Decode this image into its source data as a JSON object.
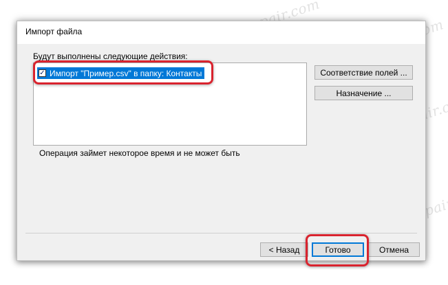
{
  "dialog": {
    "title": "Импорт файла",
    "actions_label": "Будут выполнены следующие действия:",
    "actions": [
      {
        "checked": true,
        "label": "Импорт \"Пример.csv\" в папку: Контакты"
      }
    ],
    "check_glyph": "✓",
    "note": "Операция займет некоторое время и не может быть",
    "buttons": {
      "map_fields": "Соответствие полей ...",
      "destination": "Назначение ...",
      "back": "< Назад",
      "finish": "Готово",
      "cancel": "Отмена"
    }
  },
  "watermark": "Soringpcrepair.com",
  "colors": {
    "selection": "#0078d7",
    "highlight_ring": "#d9232e"
  }
}
